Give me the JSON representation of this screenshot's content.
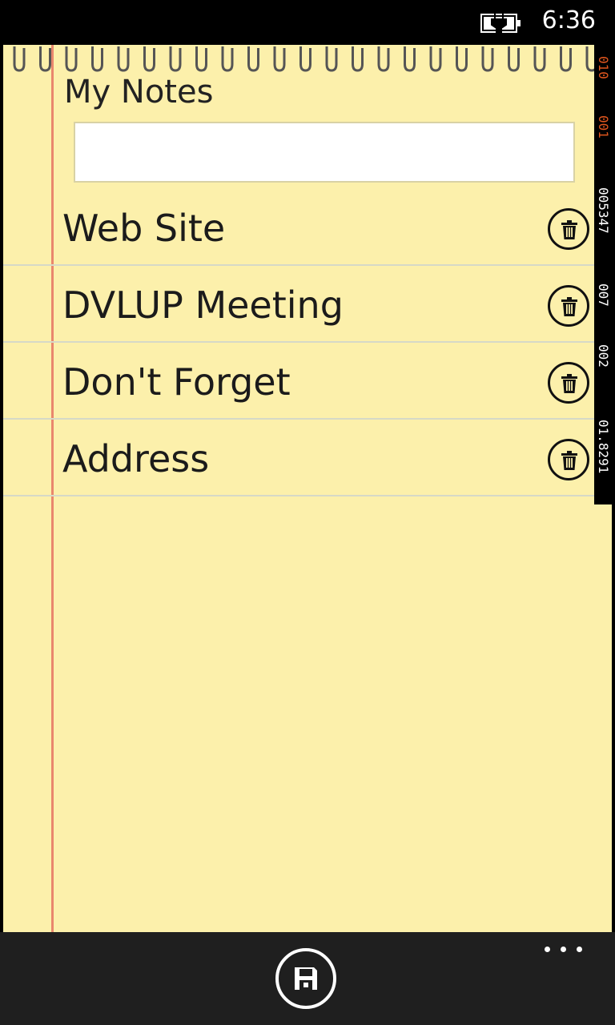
{
  "status_bar": {
    "time": "6:36",
    "battery_icon": "battery-charging-icon"
  },
  "page": {
    "title": "My Notes",
    "search_value": "",
    "search_placeholder": ""
  },
  "notes": [
    {
      "title": "Web Site",
      "delete_icon": "trash-icon"
    },
    {
      "title": "DVLUP Meeting",
      "delete_icon": "trash-icon"
    },
    {
      "title": "Don't Forget",
      "delete_icon": "trash-icon"
    },
    {
      "title": "Address",
      "delete_icon": "trash-icon"
    }
  ],
  "debug_counters": [
    {
      "text": "010",
      "color": "#e0561e"
    },
    {
      "text": "001",
      "color": "#e0561e"
    },
    {
      "text": "005347",
      "color": "#ffffff"
    },
    {
      "text": "007",
      "color": "#ffffff"
    },
    {
      "text": "002",
      "color": "#ffffff"
    },
    {
      "text": "01.8291",
      "color": "#ffffff"
    }
  ],
  "app_bar": {
    "save_icon": "save-icon",
    "more_icon": "more-icon"
  },
  "colors": {
    "paper": "#fcf0ab",
    "margin_line": "#e9876d",
    "rule_line": "#d6d9c7",
    "app_bar": "#1f1f1f"
  }
}
